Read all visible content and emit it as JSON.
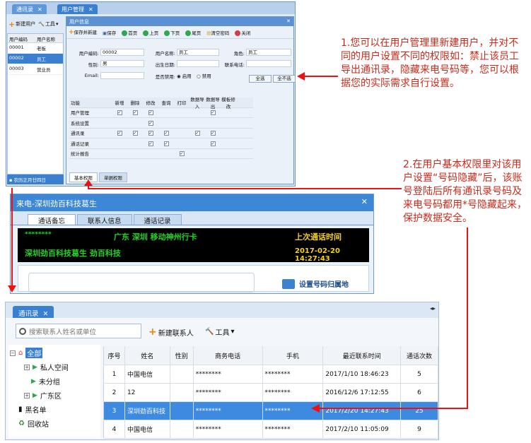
{
  "panel_user": {
    "tabs": [
      "通讯录",
      "用户管理"
    ],
    "toolbar": {
      "new_user": "新建用户",
      "tools": "工具"
    },
    "left_grid": {
      "headers": [
        "用户编码",
        "用户名称"
      ],
      "rows": [
        [
          "00001",
          "老板"
        ],
        [
          "00002",
          "员工"
        ],
        [
          "00003",
          "营业员"
        ]
      ]
    },
    "footer": "农历正月廿四日",
    "dialog": {
      "title": "用户信息",
      "tools": [
        "保存并新建",
        "保存",
        "首页",
        "上页",
        "下页",
        "尾页",
        "清空密码",
        "关闭"
      ],
      "fields": {
        "code_label": "用户编码:",
        "code_value": "00002",
        "name_label": "用户名称:",
        "name_value": "员工",
        "role_label": "角色:",
        "role_value": "员工",
        "gender_label": "性别:",
        "gender_value": "男",
        "birth_label": "出生日期:",
        "phone_label": "联系电话:",
        "email_label": "Email:",
        "disabled_label": "是否禁用:",
        "enable_label": "启用",
        "disable_label": "禁用",
        "select_all": "全选",
        "select_none": "全不选"
      },
      "perm_headers": [
        "功能",
        "新增",
        "删除",
        "修改",
        "查询",
        "打印",
        "数据导入",
        "数据导出",
        "模板修改"
      ],
      "perm_rows": [
        {
          "name": "用户管理",
          "checks": [
            1,
            1,
            1,
            0,
            0,
            0,
            1,
            0
          ]
        },
        {
          "name": "系统设置",
          "checks": [
            0,
            0,
            1,
            0,
            0,
            0,
            0,
            0
          ]
        },
        {
          "name": "通讯录",
          "checks": [
            1,
            1,
            1,
            1,
            0,
            1,
            1,
            0
          ]
        },
        {
          "name": "通话记录",
          "checks": [
            0,
            0,
            1,
            1,
            0,
            0,
            1,
            0
          ]
        },
        {
          "name": "统计报告",
          "checks": [
            0,
            0,
            0,
            0,
            1,
            0,
            0,
            0
          ]
        }
      ],
      "bottom_tabs": [
        "基本权限",
        "单据权限"
      ]
    }
  },
  "panel_caller": {
    "title": "来电-深圳劲百科技葛生",
    "tabs": [
      "通话备忘",
      "联系人信息",
      "通话记录"
    ],
    "led": {
      "masked": "********",
      "region": "广东  深圳  移动神州行卡",
      "last_call_label": "上次通话时间",
      "contact": "深圳劲百科技葛生  劲百科技",
      "last_call_time": "2017-02-20 14:27:43"
    },
    "location_btn": "设置号码归属地"
  },
  "panel_contacts": {
    "tab": "通讯录",
    "search_placeholder": "搜索联系人姓名或单位",
    "new_contact": "新建联系人",
    "tools": "工具",
    "tree": [
      "全部",
      "私人空间",
      "未分组",
      "广东区",
      "黑名单",
      "回收站"
    ],
    "headers": [
      "序号",
      "姓名",
      "性别",
      "商务电话",
      "手机",
      "最近联系时间",
      "通话次数"
    ],
    "rows": [
      [
        "1",
        "中国电信",
        "",
        "********",
        "********",
        "2017/1/10 18:46:23",
        "5"
      ],
      [
        "2",
        "12",
        "",
        "********",
        "********",
        "2016/12/6 17:12:55",
        "6"
      ],
      [
        "3",
        "深圳劲百科技",
        "",
        "********",
        "********",
        "2017/2/20 14:27:43",
        "25"
      ],
      [
        "4",
        "中国电信",
        "",
        "********",
        "********",
        "2017/2/10 11:05:09",
        "9"
      ]
    ]
  },
  "notes": {
    "note1": "1.您可以在用户管理里新建用户，并对不同的用户设置不同的权限如：禁止该员工导出通讯录，隐藏来电号码等，您可以根据您的实际需求自行设置。",
    "note2": "2.在用户基本权限里对该用户设置“号码隐藏”后，该账号登陆后所有通讯录号码及来电号码都用*号隐藏起来，保护数据安全。"
  },
  "colors": {
    "annotation": "#c62c1c",
    "accent": "#3b7fd0",
    "led_green": "#22d422",
    "led_yellow": "#f6d21c"
  }
}
